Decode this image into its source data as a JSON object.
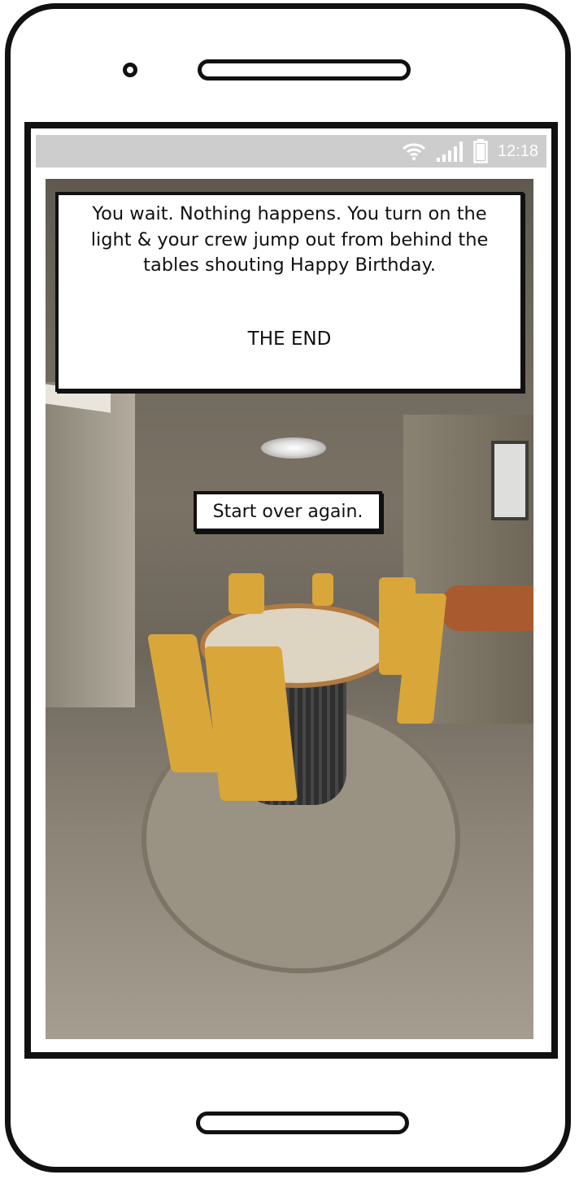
{
  "status_bar": {
    "time": "12:18",
    "icons": [
      "wifi-icon",
      "signal-icon",
      "battery-icon"
    ]
  },
  "story": {
    "text": "You wait. Nothing happens. You turn on the light & your crew jump out from behind the tables shouting Happy Birthday.",
    "ending": "THE END"
  },
  "actions": {
    "restart_label": "Start over again."
  },
  "colors": {
    "status_bar_bg": "#cdcdcd",
    "frame": "#111111",
    "dialog_bg": "#ffffff"
  }
}
